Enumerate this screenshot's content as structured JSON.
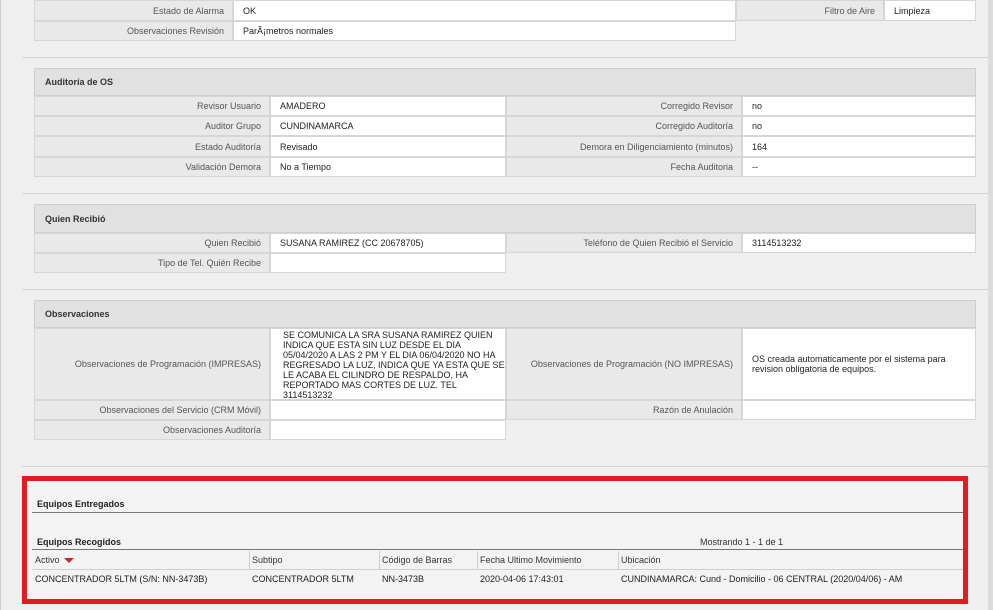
{
  "review": {
    "rows": [
      {
        "label": "Estado de Alarma",
        "value": "OK"
      },
      {
        "label": "Observaciones Revisión",
        "value": "ParÃ¡metros normales"
      }
    ],
    "right": {
      "label": "Filtro de Aire",
      "value": "Limpieza"
    }
  },
  "audit": {
    "title": "Auditoría de OS",
    "left": [
      {
        "label": "Revisor Usuario",
        "value": "AMADERO"
      },
      {
        "label": "Auditor Grupo",
        "value": "CUNDINAMARCA"
      },
      {
        "label": "Estado Auditoría",
        "value": "Revisado"
      },
      {
        "label": "Validación Demora",
        "value": "No a Tiempo"
      }
    ],
    "right": [
      {
        "label": "Corregido Revisor",
        "value": "no"
      },
      {
        "label": "Corregido Auditoría",
        "value": "no"
      },
      {
        "label": "Demora en Diligenciamiento (minutos)",
        "value": "164"
      },
      {
        "label": "Fecha Auditoria",
        "value": "--"
      }
    ]
  },
  "receiver": {
    "title": "Quien Recibió",
    "name_label": "Quien Recibió",
    "name_value": "SUSANA RAMIREZ (CC 20678705)",
    "phone_label": "Teléfono de Quien Recibió el Servicio",
    "phone_value": "3114513232",
    "phone_type_label": "Tipo de Tel. Quién Recibe",
    "phone_type_value": ""
  },
  "observations": {
    "title": "Observaciones",
    "prog_printed_label": "Observaciones de Programación (IMPRESAS)",
    "prog_printed_value": "SE COMUNICA LA SRA SUSANA RAMIREZ QUIEN\nINDICA QUE ESTA SIN LUZ DESDE EL DIA\n05/04/2020 A LAS 2 PM Y EL DIA 06/04/2020 NO HA\nREGRESADO LA LUZ, INDICA QUE YA ESTA QUE SE\nLE ACABA EL CILINDRO DE RESPALDO, HA\nREPORTADO MAS CORTES DE LUZ. TEL\n3114513232",
    "prog_unprinted_label": "Observaciones de Programación (NO IMPRESAS)",
    "prog_unprinted_value": "OS creada automaticamente por el sistema para\nrevision obligatoria de equipos.",
    "service_label": "Observaciones del Servicio (CRM Móvil)",
    "service_value": "",
    "cancel_label": "Razón de Anulación",
    "cancel_value": "",
    "audit_label": "Observaciones Auditoría",
    "audit_value": ""
  },
  "equipment": {
    "delivered_title": "Equipos Entregados",
    "collected_title": "Equipos Recogidos",
    "paging": "Mostrando 1 - 1 de 1",
    "columns": [
      "Activo",
      "Subtipo",
      "Código de Barras",
      "Fecha Ultimo Movimiento",
      "Ubicación"
    ],
    "rows": [
      [
        "CONCENTRADOR 5LTM (S/N: NN-3473B)",
        "CONCENTRADOR 5LTM",
        "NN-3473B",
        "2020-04-06 17:43:01",
        "CUNDINAMARCA: Cund - Domicilio - 06 CENTRAL (2020/04/06) - AM"
      ]
    ],
    "highlight_color": "#e31b23",
    "sort_arrow_color": "#c62828"
  }
}
